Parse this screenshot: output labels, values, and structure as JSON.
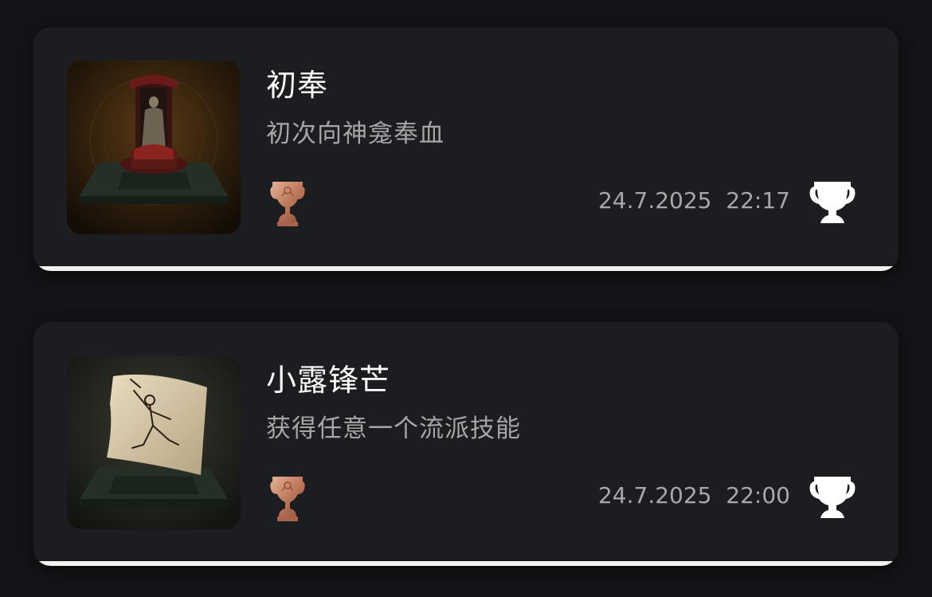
{
  "trophies": [
    {
      "title": "初奉",
      "description": "初次向神龛奉血",
      "date": "24.7.2025",
      "time": "22:17",
      "grade": "bronze",
      "thumbnail_icon": "shrine-statue-icon"
    },
    {
      "title": "小露锋芒",
      "description": "获得任意一个流派技能",
      "date": "24.7.2025",
      "time": "22:00",
      "grade": "bronze",
      "thumbnail_icon": "skill-scroll-icon"
    }
  ],
  "colors": {
    "background": "#131417",
    "card": "#1c1d20",
    "title": "#ffffff",
    "description": "#a6a6a8",
    "bronze": "#c98a6e",
    "trophy_button": "#ffffff"
  }
}
